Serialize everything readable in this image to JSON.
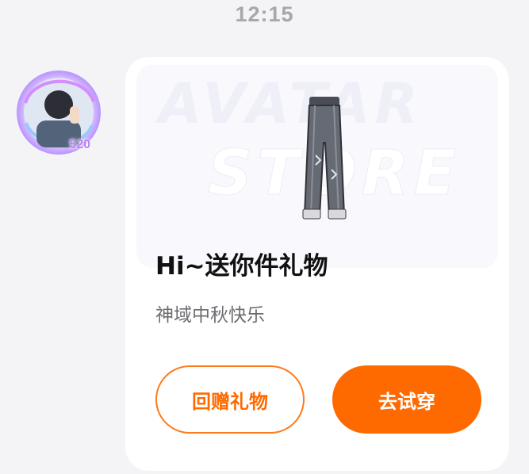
{
  "status_bar": {
    "time": "12:15"
  },
  "sender": {
    "avatar_badge": "520"
  },
  "gift_card": {
    "banner": {
      "word_top": "AVATAR",
      "word_bottom": "STORE"
    },
    "title": "Hi~送你件礼物",
    "subtitle": "神域中秋快乐",
    "buttons": {
      "return_gift": "回赠礼物",
      "try_on": "去试穿"
    }
  },
  "colors": {
    "accent": "#ff6a00",
    "background": "#f4f4f6",
    "card": "#ffffff"
  },
  "icons": {
    "avatar": "user-avatar-with-frame",
    "gift_item": "pants-icon"
  }
}
